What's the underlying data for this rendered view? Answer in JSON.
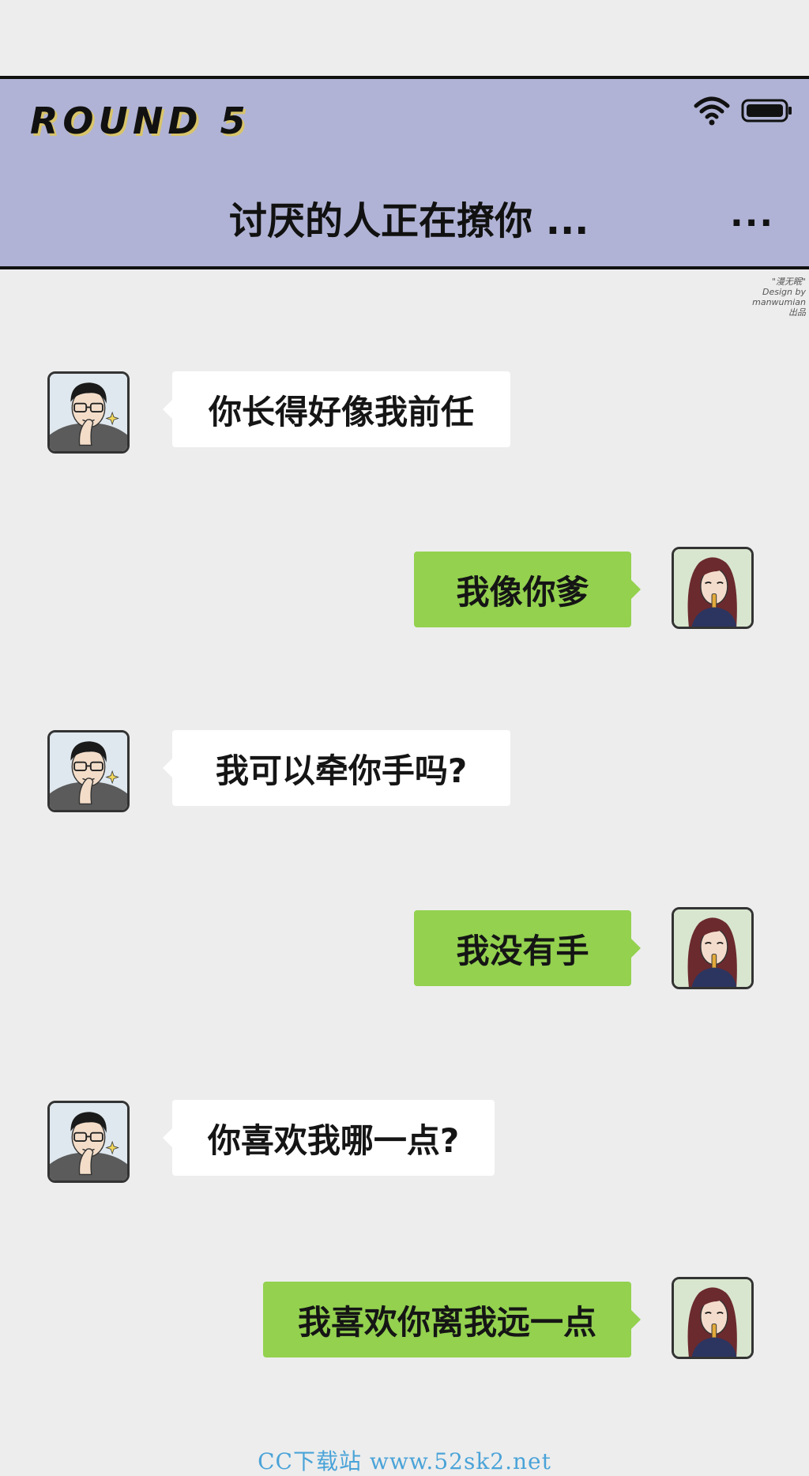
{
  "header": {
    "round_label": "ROUND 5",
    "chat_title": "讨厌的人正在撩你 ...",
    "more_label": "...",
    "status_icons": [
      "wifi-icon",
      "battery-icon"
    ]
  },
  "watermark_logo": {
    "line1": "\"漫无眠\"",
    "line2": "Design by",
    "line3": "manwumian  出品"
  },
  "colors": {
    "header_bg": "#b0b3d5",
    "page_bg": "#ededed",
    "sent_bubble": "#93d14f",
    "received_bubble": "#ffffff"
  },
  "messages": [
    {
      "side": "left",
      "sender": "male-avatar",
      "text": "你长得好像我前任"
    },
    {
      "side": "right",
      "sender": "female-avatar",
      "text": "我像你爹"
    },
    {
      "side": "left",
      "sender": "male-avatar",
      "text": "我可以牵你手吗?"
    },
    {
      "side": "right",
      "sender": "female-avatar",
      "text": "我没有手"
    },
    {
      "side": "left",
      "sender": "male-avatar",
      "text": "你喜欢我哪一点?"
    },
    {
      "side": "right",
      "sender": "female-avatar",
      "text": "我喜欢你离我远一点"
    }
  ],
  "footer": {
    "watermark": "CC下载站 www.52sk2.net"
  }
}
